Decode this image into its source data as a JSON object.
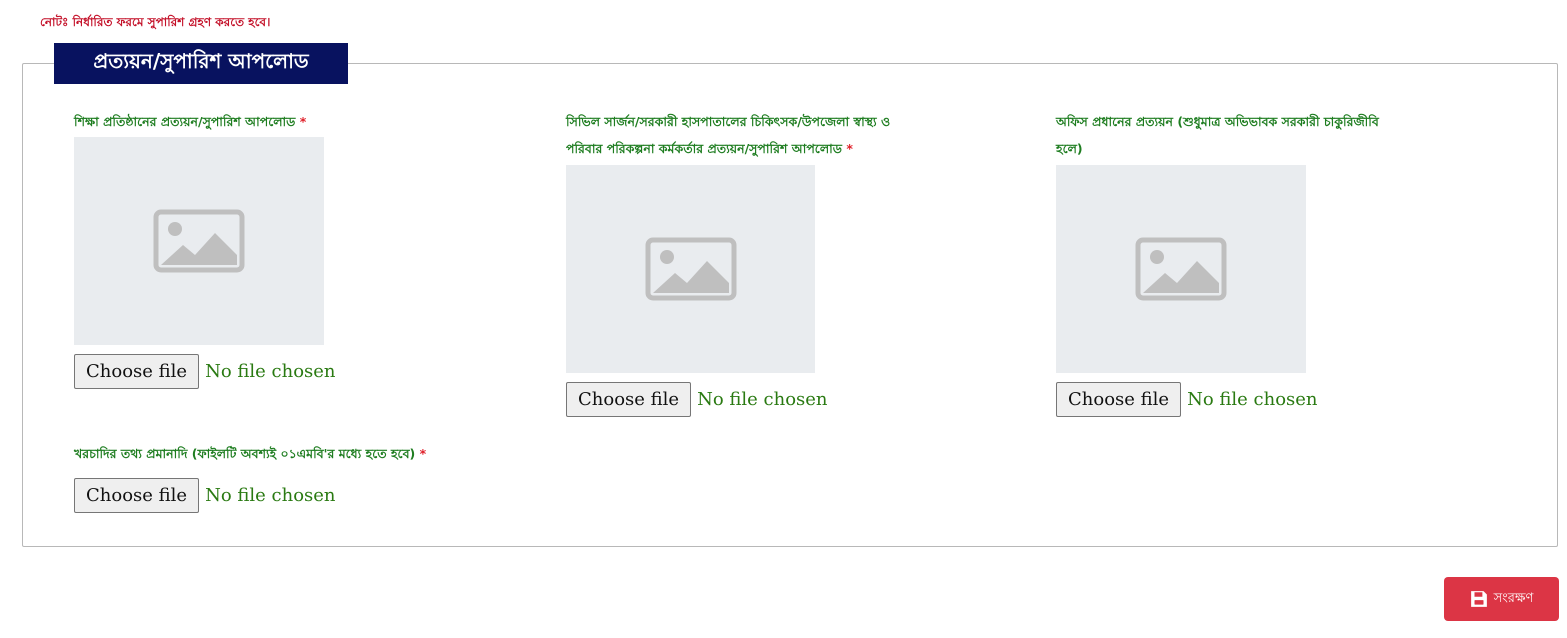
{
  "note": "নোটঃ নির্ধারিত ফরমে সুপারিশ গ্রহণ করতে হবে।",
  "section": {
    "title": "প্রত্যয়ন/সুপারিশ আপলোড"
  },
  "required_mark": "*",
  "fields": [
    {
      "label": "শিক্ষা প্রতিষ্ঠানের প্রত্যয়ন/সুপারিশ আপলোড",
      "required": true,
      "button_label": "Choose file",
      "status": "No file chosen"
    },
    {
      "label_line1": "সিভিল সার্জন/সরকারী হাসপাতালের চিকিৎসক/উপজেলা স্বাস্থ্য ও",
      "label_line2": "পরিবার পরিকল্পনা কর্মকর্তার প্রত্যয়ন/সুপারিশ আপলোড",
      "required": true,
      "button_label": "Choose file",
      "status": "No file chosen"
    },
    {
      "label_line1": "অফিস প্রধানের প্রত্যয়ন (শুধুমাত্র অভিভাবক সরকারী চাকুরিজীবি",
      "label_line2": "হলে)",
      "required": false,
      "button_label": "Choose file",
      "status": "No file chosen"
    },
    {
      "label": "খরচাদির তথ্য প্রমানাদি (ফাইলটি অবশ্যই ০১এমবি'র মধ্যে হতে হবে)",
      "required": true,
      "button_label": "Choose file",
      "status": "No file chosen"
    }
  ],
  "save_button": {
    "label": "সংরক্ষণ",
    "icon": "floppy-disk-icon"
  },
  "colors": {
    "note": "#c4122a",
    "legend_bg": "#08125f",
    "label_green": "#1e7d20",
    "required_red": "#e0202a",
    "preview_bg": "#e9ecef",
    "save_bg": "#dc3545"
  }
}
